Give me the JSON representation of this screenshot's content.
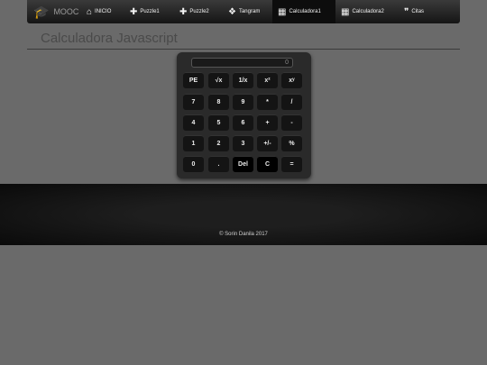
{
  "navbar": {
    "brand": {
      "icon": "graduation-cap-icon",
      "label": "MOOC"
    },
    "items": [
      {
        "icon": "home-icon",
        "label": "INICIO"
      },
      {
        "icon": "puzzle-icon",
        "label": "Puzzle1"
      },
      {
        "icon": "puzzle-icon",
        "label": "Puzzle2"
      },
      {
        "icon": "cubes-icon",
        "label": "Tangram"
      },
      {
        "icon": "calculator-icon",
        "label": "Calculadora1",
        "active": true
      },
      {
        "icon": "calculator-icon",
        "label": "Calculadora2"
      },
      {
        "icon": "quote-icon",
        "label": "Citas"
      }
    ]
  },
  "page": {
    "title": "Calculadora Javascript"
  },
  "calculator": {
    "display": "0",
    "rows": [
      [
        "PE",
        "√x",
        "1/x",
        "x²",
        "xʸ"
      ],
      [
        "7",
        "8",
        "9",
        "*",
        "/"
      ],
      [
        "4",
        "5",
        "6",
        "+",
        "-"
      ],
      [
        "1",
        "2",
        "3",
        "+/-",
        "%"
      ],
      [
        "0",
        ".",
        "Del",
        "C",
        "="
      ]
    ]
  },
  "footer": {
    "text": "© Sorin Danila 2017"
  }
}
